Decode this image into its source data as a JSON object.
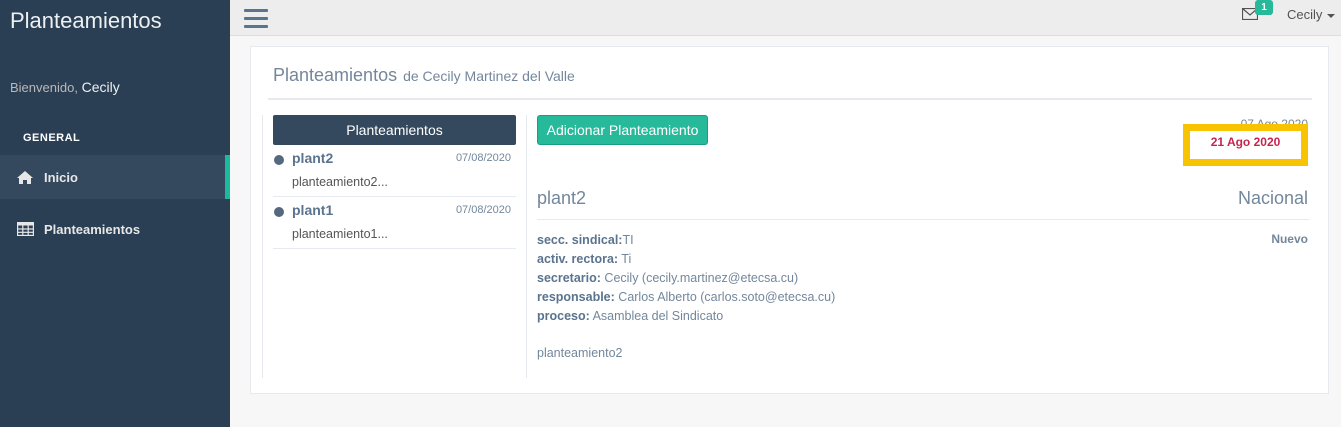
{
  "sidebar": {
    "brand": "Planteamientos",
    "welcome_prefix": "Bienvenido,",
    "welcome_user": "Cecily",
    "section": "GENERAL",
    "items": [
      {
        "label": "Inicio",
        "icon": "home-icon"
      },
      {
        "label": "Planteamientos",
        "icon": "table-icon"
      }
    ]
  },
  "topbar": {
    "notification_count": "1",
    "user": "Cecily"
  },
  "panel": {
    "title": "Planteamientos",
    "subtitle": "de Cecily Martinez del Valle"
  },
  "list": {
    "header": "Planteamientos",
    "items": [
      {
        "name": "plant2",
        "date": "07/08/2020",
        "desc": "planteamiento2..."
      },
      {
        "name": "plant1",
        "date": "07/08/2020",
        "desc": "planteamiento1..."
      }
    ]
  },
  "detail": {
    "add_button": "Adicionar Planteamiento",
    "date_created": "07 Ago 2020",
    "date_due": "21 Ago 2020",
    "title": "plant2",
    "scope": "Nacional",
    "status": "Nuevo",
    "fields": [
      {
        "label": "secc. sindical:",
        "value": "TI"
      },
      {
        "label": "activ. rectora:",
        "value": " Ti"
      },
      {
        "label": "secretario:",
        "value": " Cecily (cecily.martinez@etecsa.cu)"
      },
      {
        "label": "responsable:",
        "value": " Carlos Alberto (carlos.soto@etecsa.cu)"
      },
      {
        "label": "proceso:",
        "value": " Asamblea del Sindicato"
      }
    ],
    "description": "planteamiento2"
  },
  "colors": {
    "sidebar_bg": "#2a3f54",
    "accent": "#26b99a",
    "highlight_border": "#f7c302",
    "due_date": "#c7254e"
  }
}
